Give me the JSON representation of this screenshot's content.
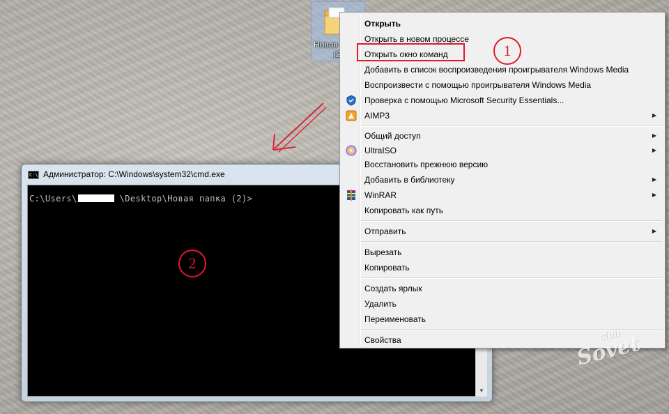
{
  "desktop": {
    "folder_label_line1": "Новая",
    "folder_label_line2": "(2)"
  },
  "cmd_window": {
    "title": "Администратор: C:\\Windows\\system32\\cmd.exe",
    "icon_text": "C:\\",
    "prompt": "C:\\Users\\        \\Desktop\\Новая папка (2)>"
  },
  "context_menu": {
    "items": [
      {
        "label": "Открыть",
        "bold": true
      },
      {
        "label": "Открыть в новом процессе"
      },
      {
        "label": "Открыть окно команд"
      },
      {
        "label": "Добавить в список воспроизведения проигрывателя Windows Media"
      },
      {
        "label": "Воспроизвести с помощью проигрывателя Windows Media"
      },
      {
        "label": "Проверка с помощью Microsoft Security Essentials...",
        "icon": "security-essentials-icon"
      },
      {
        "label": "AIMP3",
        "icon": "aimp-icon",
        "submenu": true
      },
      {
        "label": "Общий доступ",
        "submenu": true
      },
      {
        "label": "UltraISO",
        "icon": "ultraiso-icon",
        "submenu": true
      },
      {
        "label": "Восстановить прежнюю версию"
      },
      {
        "label": "Добавить в библиотеку",
        "submenu": true
      },
      {
        "label": "WinRAR",
        "icon": "winrar-icon",
        "submenu": true
      },
      {
        "label": "Копировать как путь"
      },
      {
        "label": "Отправить",
        "submenu": true
      },
      {
        "label": "Вырезать"
      },
      {
        "label": "Копировать"
      },
      {
        "label": "Создать ярлык"
      },
      {
        "label": "Удалить"
      },
      {
        "label": "Переименовать"
      },
      {
        "label": "Свойства"
      }
    ]
  },
  "annotations": {
    "marker_1": "1",
    "marker_2": "2",
    "highlight_color": "#e0192b"
  },
  "watermark": {
    "small": "club",
    "big": "Sovet"
  },
  "colors": {
    "menu_background": "#f0f0f0",
    "console_background": "#000000",
    "console_text": "#c0c0c0"
  }
}
